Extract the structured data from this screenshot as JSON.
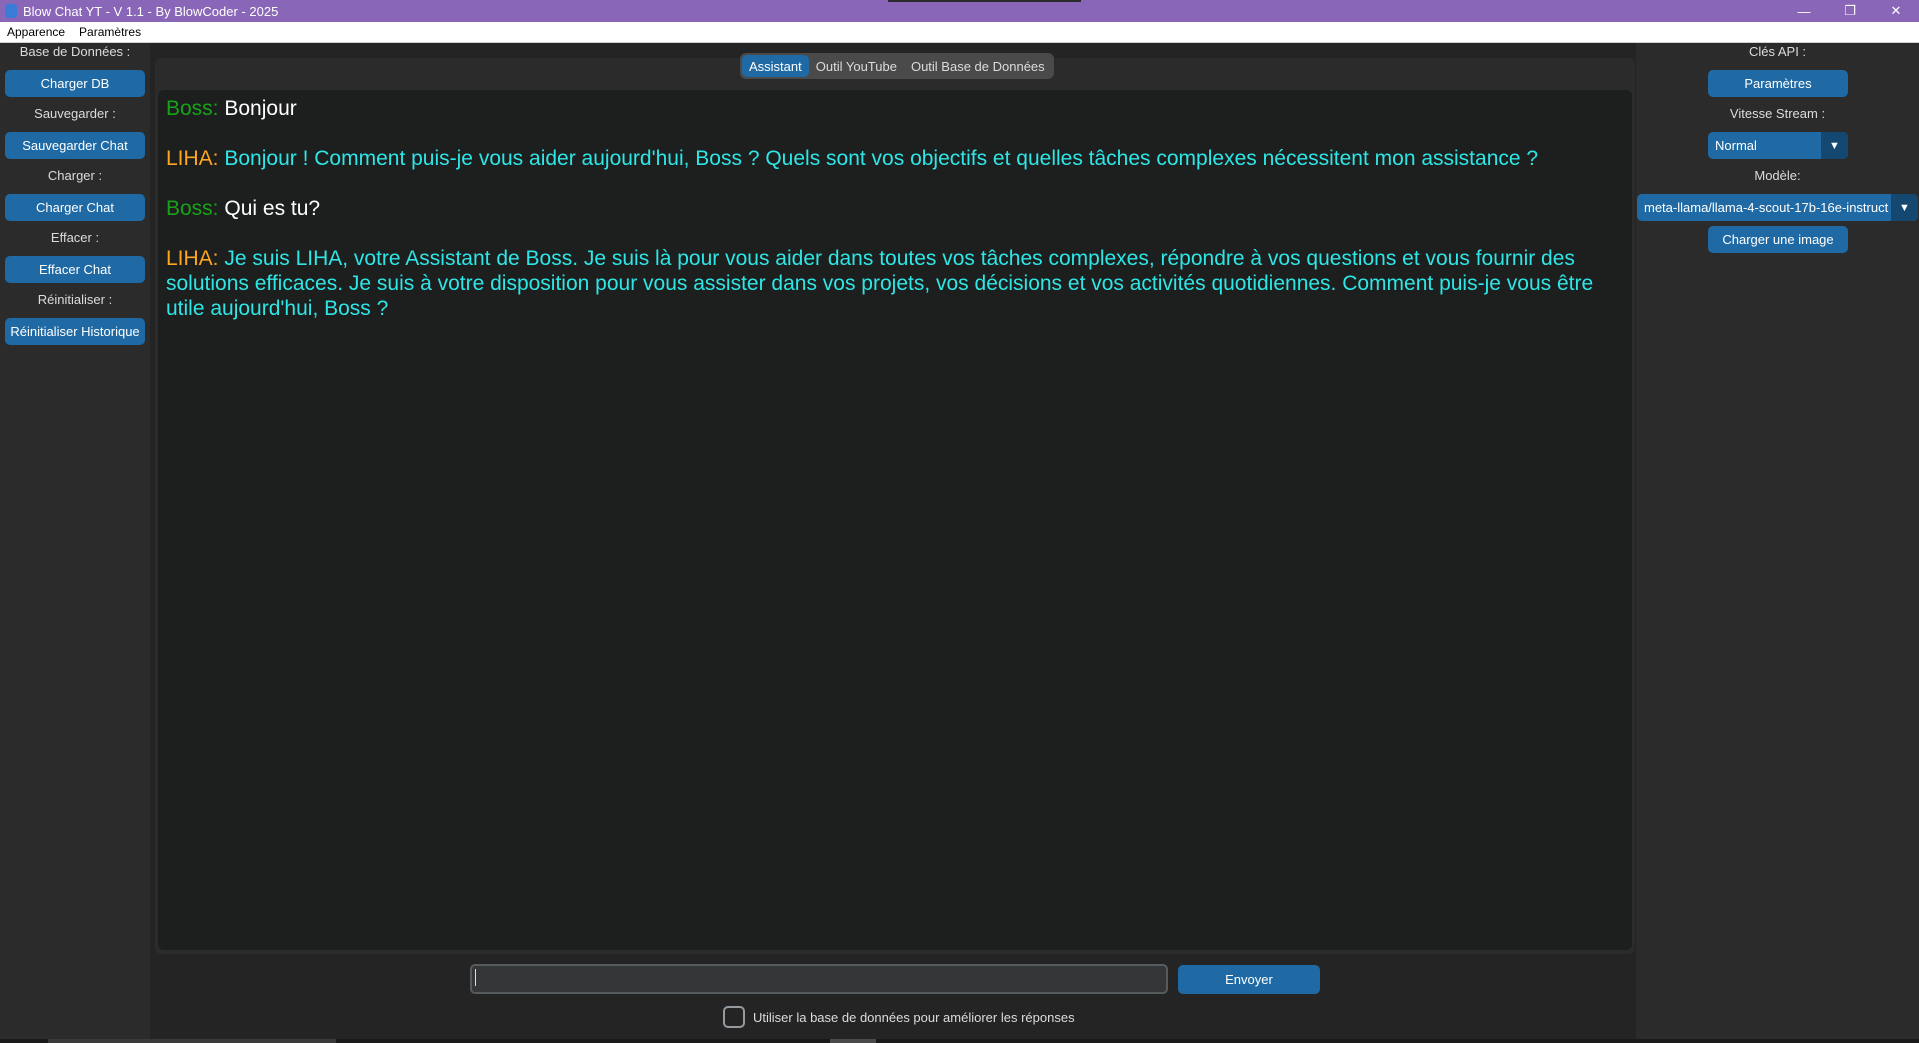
{
  "window": {
    "title": "Blow Chat YT - V 1.1 - By BlowCoder - 2025",
    "controls": {
      "minimize": "—",
      "restore": "❐",
      "close": "✕"
    }
  },
  "menu": {
    "items": [
      "Apparence",
      "Paramètres"
    ]
  },
  "left_sidebar": {
    "db_label": "Base de Données :",
    "load_db": "Charger DB",
    "save_label": "Sauvegarder :",
    "save_chat": "Sauvegarder Chat",
    "load_label": "Charger :",
    "load_chat": "Charger Chat",
    "clear_label": "Effacer :",
    "clear_chat": "Effacer Chat",
    "reset_label": "Réinitialiser :",
    "reset_history": "Réinitialiser Historique"
  },
  "tabs": [
    "Assistant",
    "Outil YouTube",
    "Outil Base de Données"
  ],
  "active_tab": "Assistant",
  "chat": [
    {
      "speaker": "Boss:",
      "text": "Bonjour",
      "role": "boss"
    },
    {
      "speaker": "LIHA:",
      "text": "Bonjour ! Comment puis-je vous aider aujourd'hui, Boss ? Quels sont vos objectifs et quelles tâches complexes nécessitent mon assistance ?",
      "role": "liha"
    },
    {
      "speaker": "Boss:",
      "text": "Qui es tu?",
      "role": "boss"
    },
    {
      "speaker": "LIHA:",
      "text": "Je suis LIHA, votre Assistant de Boss. Je suis là pour vous aider dans toutes vos tâches complexes, répondre à vos questions et vous fournir des solutions efficaces. Je suis à votre disposition pour vous assister dans vos projets, vos décisions et vos activités quotidiennes. Comment puis-je vous être utile aujourd'hui, Boss ?",
      "role": "liha"
    }
  ],
  "input": {
    "value": "",
    "send_label": "Envoyer"
  },
  "db_checkbox": {
    "label": "Utiliser la base de données pour améliorer les réponses",
    "checked": false
  },
  "right_sidebar": {
    "api_label": "Clés API :",
    "settings_button": "Paramètres",
    "stream_label": "Vitesse Stream :",
    "stream_value": "Normal",
    "model_label": "Modèle:",
    "model_value": "meta-llama/llama-4-scout-17b-16e-instruct",
    "load_image": "Charger une image"
  },
  "colors": {
    "accent": "#1f6aa5",
    "titlebar": "#8a66b8",
    "boss_speaker": "#17a317",
    "liha_speaker": "#ffa51f",
    "liha_text": "#2ee6e6"
  }
}
